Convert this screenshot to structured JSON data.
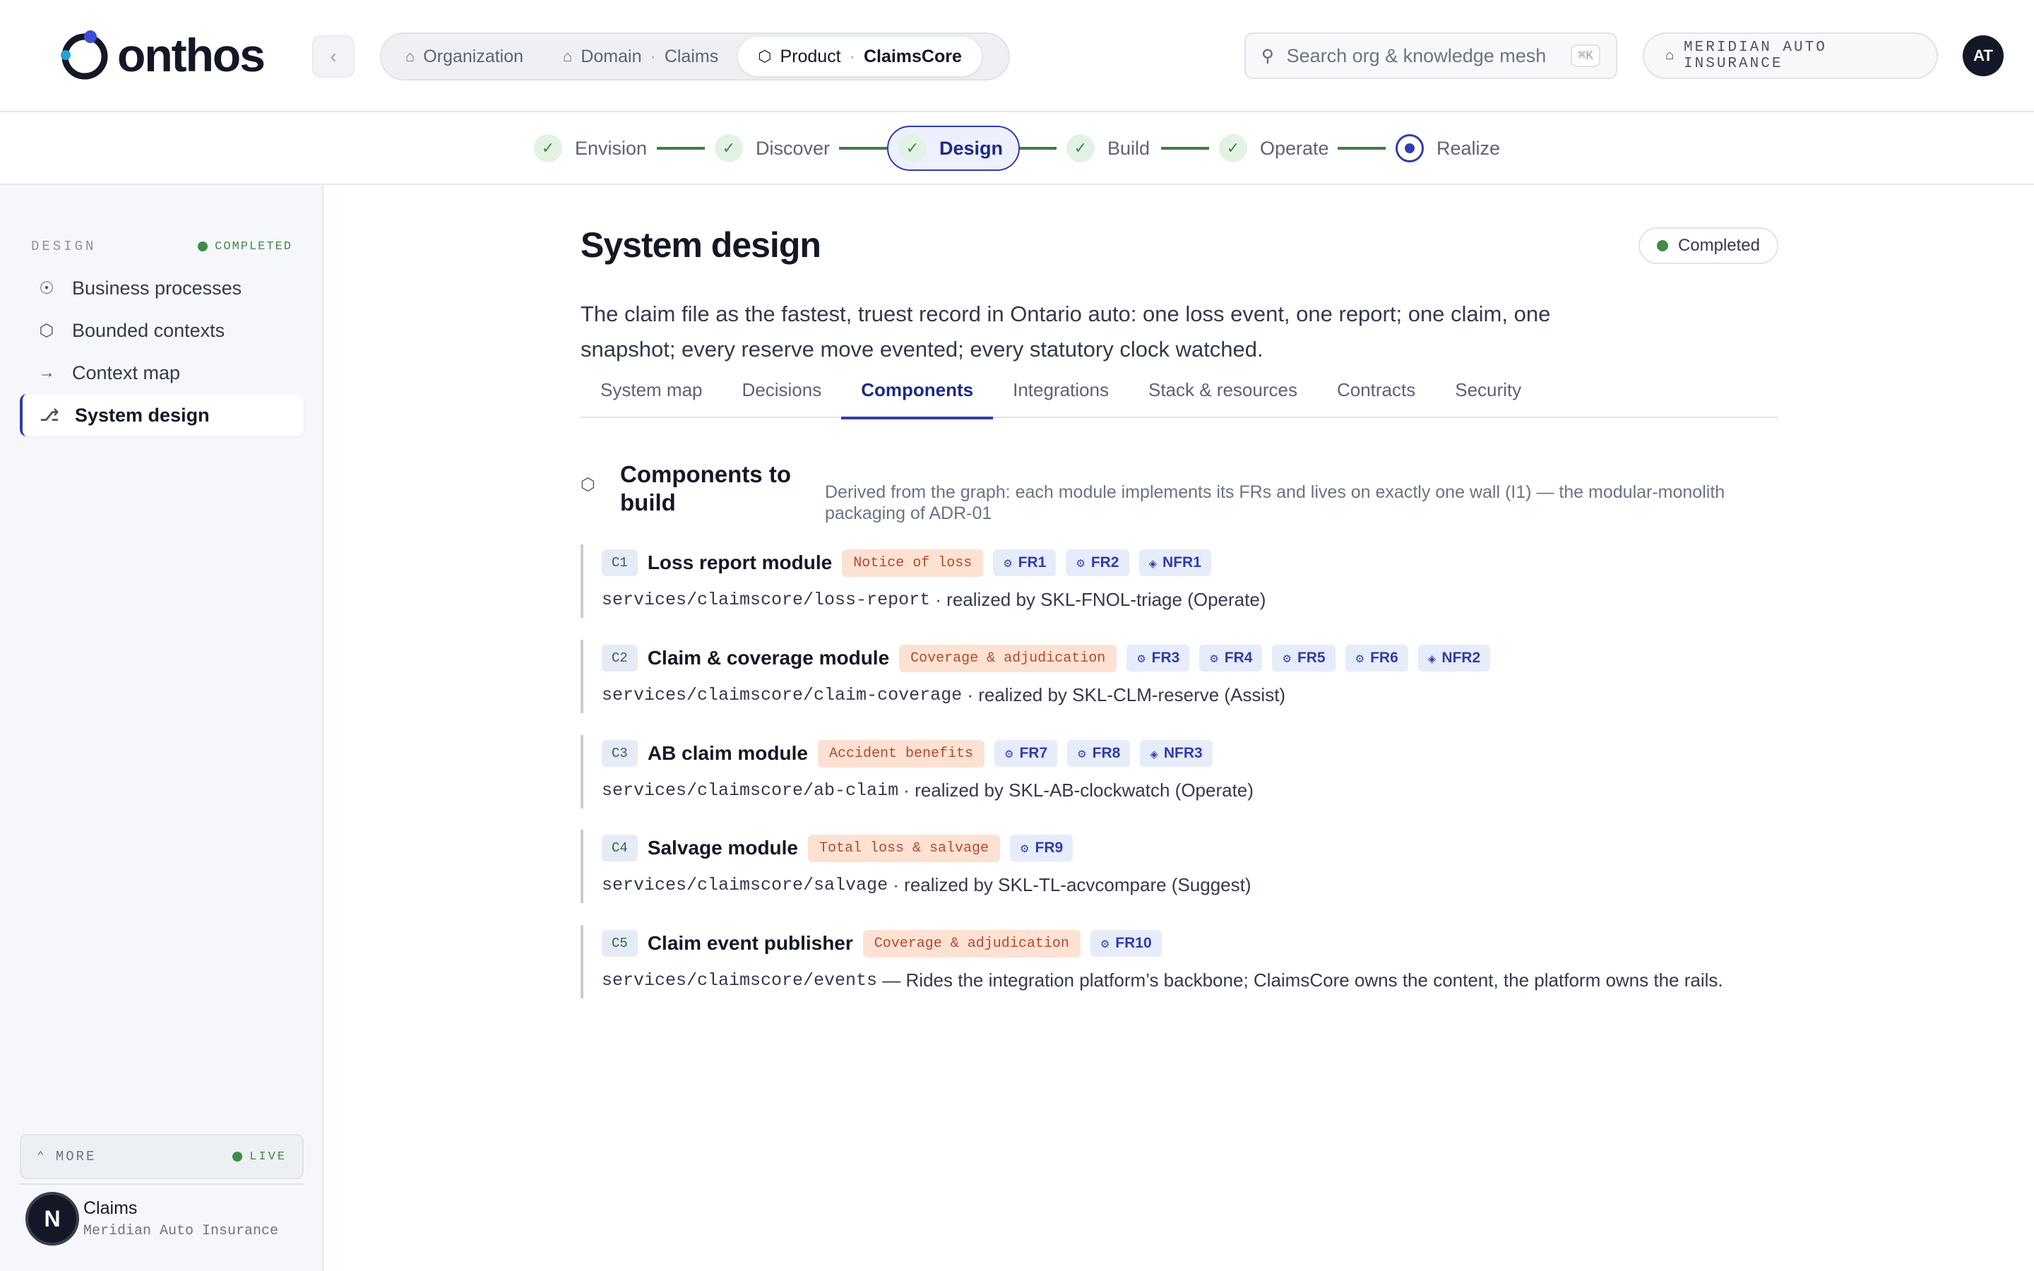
{
  "brand": {
    "name": "onthos"
  },
  "breadcrumb": [
    {
      "label": "Organization",
      "value": ""
    },
    {
      "label": "Domain",
      "value": "Claims"
    },
    {
      "label": "Product",
      "value": "ClaimsCore"
    }
  ],
  "search": {
    "placeholder": "Search org & knowledge mesh",
    "shortcut": "⌘K"
  },
  "org_chip": "MERIDIAN AUTO INSURANCE",
  "user_initials": "AT",
  "stepper": [
    {
      "label": "Envision",
      "state": "done"
    },
    {
      "label": "Discover",
      "state": "done"
    },
    {
      "label": "Design",
      "state": "active"
    },
    {
      "label": "Build",
      "state": "done"
    },
    {
      "label": "Operate",
      "state": "done"
    },
    {
      "label": "Realize",
      "state": "current"
    }
  ],
  "sidebar": {
    "section": "DESIGN",
    "status": "COMPLETED",
    "items": [
      {
        "label": "Business processes",
        "icon": "compass-icon"
      },
      {
        "label": "Bounded contexts",
        "icon": "cube-icon"
      },
      {
        "label": "Context map",
        "icon": "arrow-right-icon"
      },
      {
        "label": "System design",
        "icon": "network-icon"
      }
    ],
    "more": "MORE",
    "live": "LIVE",
    "workspace": {
      "avatar": "N",
      "name": "Claims",
      "org": "Meridian Auto Insurance"
    }
  },
  "main": {
    "title": "System design",
    "badge": "Completed",
    "summary": "The claim file as the fastest, truest record in Ontario auto: one loss event, one report; one claim, one snapshot; every reserve move evented; every statutory clock watched.",
    "tabs": [
      "System map",
      "Decisions",
      "Components",
      "Integrations",
      "Stack & resources",
      "Contracts",
      "Security"
    ],
    "active_tab": "Components",
    "section_title": "Components to build",
    "section_desc": "Derived from the graph: each module implements its FRs and lives on exactly one wall (I1) — the modular-monolith packaging of ADR-01",
    "components": [
      {
        "id": "C1",
        "name": "Loss report module",
        "context": "Notice of loss",
        "reqs": [
          "FR1",
          "FR2",
          "NFR1"
        ],
        "path": "services/claimscore/loss-report",
        "note": " · realized by SKL-FNOL-triage (Operate)"
      },
      {
        "id": "C2",
        "name": "Claim & coverage module",
        "context": "Coverage & adjudication",
        "reqs": [
          "FR3",
          "FR4",
          "FR5",
          "FR6",
          "NFR2"
        ],
        "path": "services/claimscore/claim-coverage",
        "note": " · realized by SKL-CLM-reserve (Assist)"
      },
      {
        "id": "C3",
        "name": "AB claim module",
        "context": "Accident benefits",
        "reqs": [
          "FR7",
          "FR8",
          "NFR3"
        ],
        "path": "services/claimscore/ab-claim",
        "note": " · realized by SKL-AB-clockwatch (Operate)"
      },
      {
        "id": "C4",
        "name": "Salvage module",
        "context": "Total loss & salvage",
        "reqs": [
          "FR9"
        ],
        "path": "services/claimscore/salvage",
        "note": " · realized by SKL-TL-acvcompare (Suggest)"
      },
      {
        "id": "C5",
        "name": "Claim event publisher",
        "context": "Coverage & adjudication",
        "reqs": [
          "FR10"
        ],
        "path": "services/claimscore/events",
        "note": " — Rides the integration platform’s backbone; ClaimsCore owns the content, the platform owns the rails."
      }
    ]
  }
}
